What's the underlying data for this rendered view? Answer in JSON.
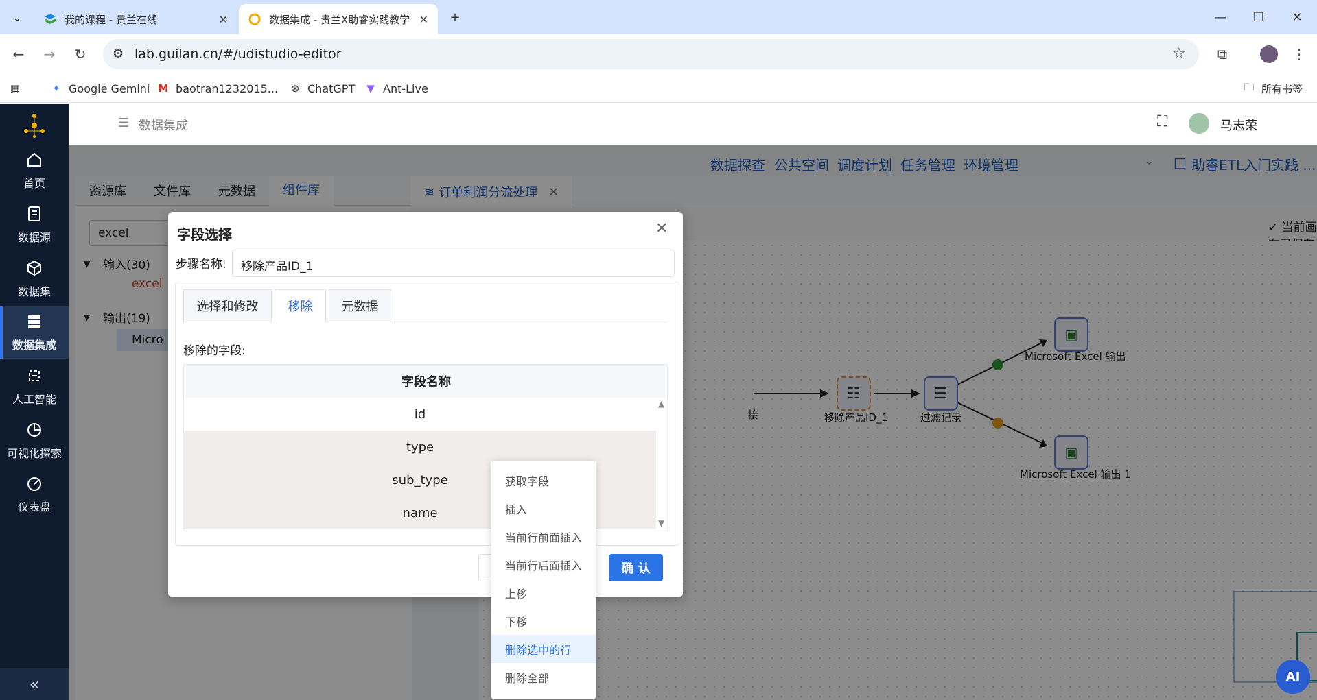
{
  "browser": {
    "tabs": [
      {
        "title": "我的课程 - 贵兰在线",
        "active": false
      },
      {
        "title": "数据集成 - 贵兰X助睿实践教学",
        "active": true
      }
    ],
    "url": "lab.guilan.cn/#/udistudio-editor",
    "bookmarks": [
      "Google Gemini",
      "baotran1232015...",
      "ChatGPT",
      "Ant-Live"
    ],
    "all_bookmarks": "所有书签"
  },
  "sidebar": {
    "items": [
      {
        "label": "首页",
        "icon": "home-icon"
      },
      {
        "label": "数据源",
        "icon": "datasource-icon"
      },
      {
        "label": "数据集",
        "icon": "dataset-icon"
      },
      {
        "label": "数据集成",
        "icon": "integration-icon"
      },
      {
        "label": "人工智能",
        "icon": "ai-icon"
      },
      {
        "label": "可视化探索",
        "icon": "chart-icon"
      },
      {
        "label": "仪表盘",
        "icon": "gauge-icon"
      }
    ],
    "collapse": "«"
  },
  "header": {
    "breadcrumb": "数据集成",
    "user": "马志荣"
  },
  "topnav": {
    "links": [
      "数据探查",
      "公共空间",
      "调度计划",
      "任务管理",
      "环境管理"
    ],
    "project": "助睿ETL入门实践 ..."
  },
  "left_panel": {
    "tabs": [
      "资源库",
      "文件库",
      "元数据",
      "组件库"
    ],
    "search_value": "excel",
    "tree": {
      "input_folder": "输入(30)",
      "input_item": "excel",
      "output_folder": "输出(19)",
      "output_item": "Micro"
    }
  },
  "editor": {
    "tab_title": "订单利润分流处理",
    "saved_status": "当前画布已保存"
  },
  "canvas_nodes": {
    "left_label": "接",
    "remove_id": "移除产品ID_1",
    "filter": "过滤记录",
    "excel_out": "Microsoft Excel 输出",
    "excel_out_1": "Microsoft Excel 输出 1"
  },
  "dialog": {
    "title": "字段选择",
    "step_label": "步骤名称:",
    "step_value": "移除产品ID_1",
    "tabs": [
      "选择和修改",
      "移除",
      "元数据"
    ],
    "active_tab": 1,
    "remove_label": "移除的字段:",
    "column_header": "字段名称",
    "rows": [
      "id",
      "type",
      "sub_type",
      "name"
    ],
    "confirm": "确 认"
  },
  "context_menu": {
    "items": [
      "获取字段",
      "插入",
      "当前行前面插入",
      "当前行后面插入",
      "上移",
      "下移",
      "删除选中的行",
      "删除全部"
    ],
    "highlighted": 6
  },
  "ai_button": "AI"
}
